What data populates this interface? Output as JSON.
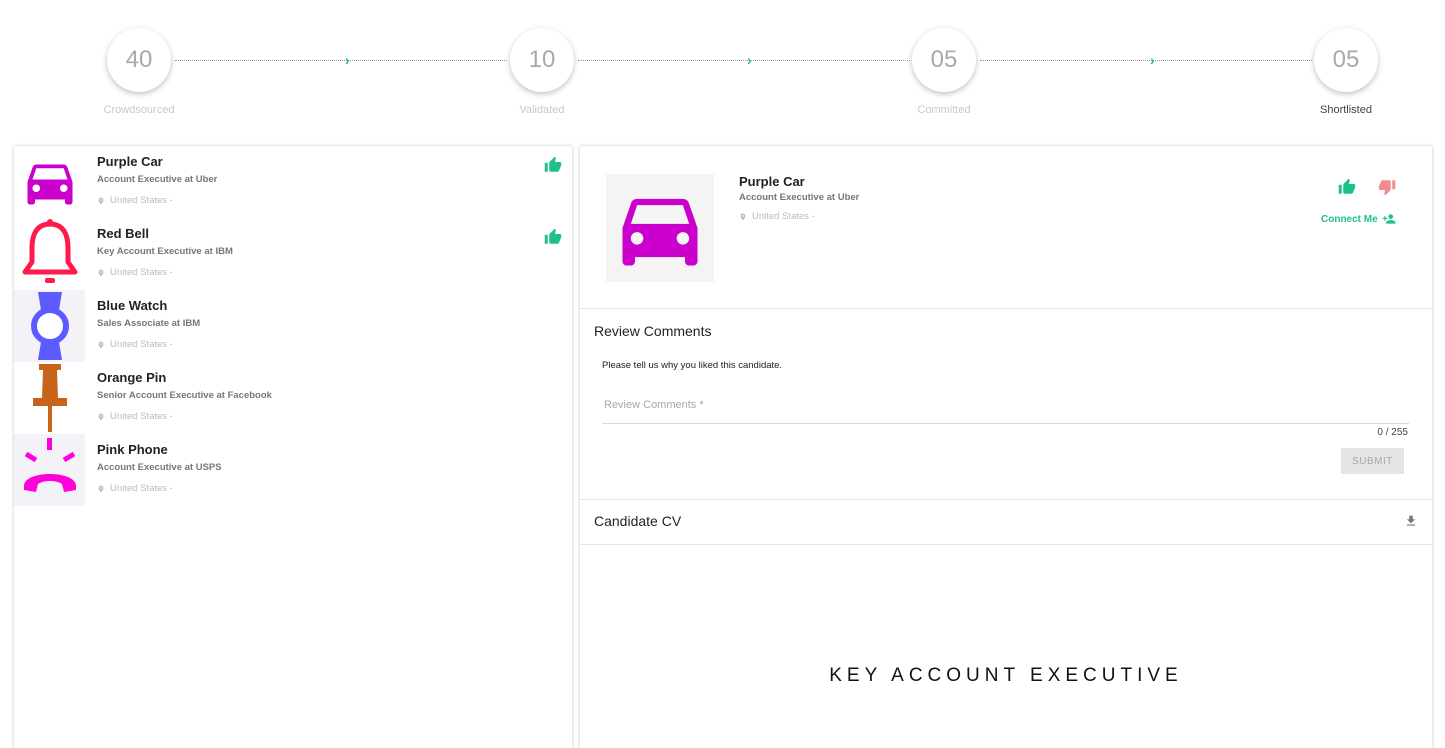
{
  "stepper": {
    "steps": [
      {
        "count": "40",
        "label": "Crowdsourced"
      },
      {
        "count": "10",
        "label": "Validated"
      },
      {
        "count": "05",
        "label": "Committed"
      },
      {
        "count": "05",
        "label": "Shortlisted"
      }
    ],
    "arrow": "›"
  },
  "candidates": [
    {
      "name": "Purple Car",
      "title": "Account Executive at Uber",
      "location": "United States -",
      "icon": "car-icon",
      "color": "#cc00cc",
      "liked": true
    },
    {
      "name": "Red Bell",
      "title": "Key Account Executive at IBM",
      "location": "United States -",
      "icon": "bell-icon",
      "color": "#ff1a4b",
      "liked": true
    },
    {
      "name": "Blue Watch",
      "title": "Sales Associate at IBM",
      "location": "United States -",
      "icon": "watch-icon",
      "color": "#5b5bff",
      "liked": false
    },
    {
      "name": "Orange Pin",
      "title": "Senior Account Executive at Facebook",
      "location": "United States -",
      "icon": "pin-icon",
      "color": "#c8641a",
      "liked": false
    },
    {
      "name": "Pink Phone",
      "title": "Account Executive at USPS",
      "location": "United States -",
      "icon": "phone-icon",
      "color": "#ff00dd",
      "liked": false
    }
  ],
  "detail": {
    "name": "Purple Car",
    "title": "Account Executive at Uber",
    "location": "United States -",
    "connect_label": "Connect Me",
    "colors": {
      "accent": "#1fc08e",
      "dislike": "#f28b8b"
    }
  },
  "review": {
    "heading": "Review Comments",
    "hint": "Please tell us why you liked this candidate.",
    "placeholder": "Review Comments *",
    "value": "",
    "counter": "0 / 255",
    "submit_label": "SUBMIT"
  },
  "cv": {
    "heading": "Candidate CV",
    "document_heading": "KEY ACCOUNT EXECUTIVE"
  }
}
